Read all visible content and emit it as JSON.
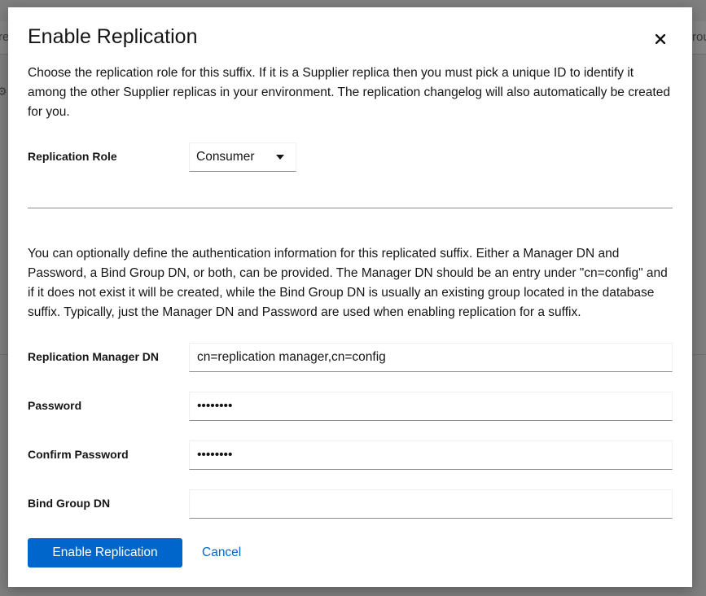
{
  "background": {
    "left_fragment": "re",
    "right_fragment": "rou",
    "gear_icon": "gear-icon"
  },
  "modal": {
    "title": "Enable Replication",
    "close_icon": "close-icon",
    "description_1": "Choose the replication role for this suffix. If it is a Supplier replica then you must pick a unique ID to identify it among the other Supplier replicas in your environment. The replication changelog will also automatically be created for you.",
    "description_2": "You can optionally define the authentication information for this replicated suffix. Either a Manager DN and Password, a Bind Group DN, or both, can be provided. The Manager DN should be an entry under \"cn=config\" and if it does not exist it will be created, while the Bind Group DN is usually an existing group located in the database suffix. Typically, just the Manager DN and Password are used when enabling replication for a suffix.",
    "role": {
      "label": "Replication Role",
      "selected": "Consumer"
    },
    "manager_dn": {
      "label": "Replication Manager DN",
      "value": "cn=replication manager,cn=config"
    },
    "password": {
      "label": "Password",
      "value": "••••••••"
    },
    "confirm_password": {
      "label": "Confirm Password",
      "value": "••••••••"
    },
    "bind_group_dn": {
      "label": "Bind Group DN",
      "value": ""
    },
    "enable_button": "Enable Replication",
    "cancel_button": "Cancel"
  },
  "colors": {
    "primary": "#0066cc",
    "overlay": "#7f7f7f",
    "text": "#151515"
  }
}
